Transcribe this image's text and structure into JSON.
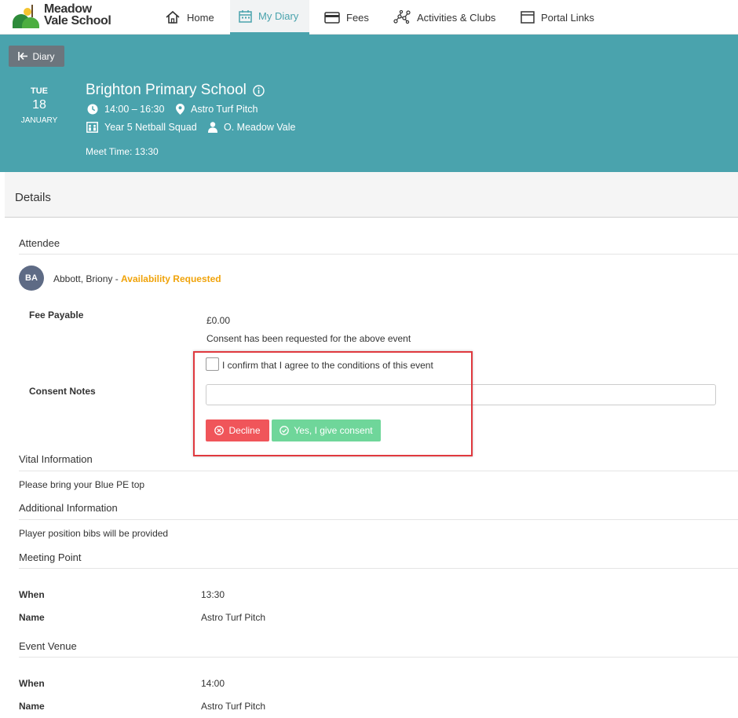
{
  "brand": {
    "line1": "Meadow",
    "line2": "Vale School"
  },
  "nav": {
    "home": "Home",
    "diary": "My Diary",
    "fees": "Fees",
    "activities": "Activities & Clubs",
    "portal": "Portal Links"
  },
  "banner": {
    "back_label": "Diary",
    "date": {
      "dow": "TUE",
      "day": "18",
      "month": "JANUARY"
    },
    "title": "Brighton Primary School",
    "time": "14:00 – 16:30",
    "location": "Astro Turf Pitch",
    "group": "Year 5 Netball Squad",
    "organiser": "O. Meadow Vale",
    "meet_time": "Meet Time: 13:30"
  },
  "details": {
    "heading": "Details",
    "attendee_heading": "Attendee",
    "attendee": {
      "initials": "BA",
      "name": "Abbott, Briony - ",
      "status": "Availability Requested"
    },
    "fee_label": "Fee Payable",
    "fee_value": "£0.00",
    "consent_request": "Consent has been requested for the above event",
    "confirm_label": "I confirm that I agree to the conditions of this event",
    "notes_label": "Consent Notes",
    "notes_value": "",
    "decline_label": "Decline",
    "consent_label": "Yes, I give consent",
    "vital_heading": "Vital Information",
    "vital_text": "Please bring your Blue PE top",
    "additional_heading": "Additional Information",
    "additional_text": "Player position bibs will be provided",
    "meeting_heading": "Meeting Point",
    "meeting_when_label": "When",
    "meeting_when": "13:30",
    "meeting_name_label": "Name",
    "meeting_name": "Astro Turf Pitch",
    "venue_heading": "Event Venue",
    "venue_when_label": "When",
    "venue_when": "14:00",
    "venue_name_label": "Name",
    "venue_name": "Astro Turf Pitch"
  },
  "colors": {
    "teal": "#4aa3ad",
    "decline": "#f0555a",
    "consent": "#6fd69a",
    "status": "#f0a30a",
    "highlight": "#e0393f"
  }
}
